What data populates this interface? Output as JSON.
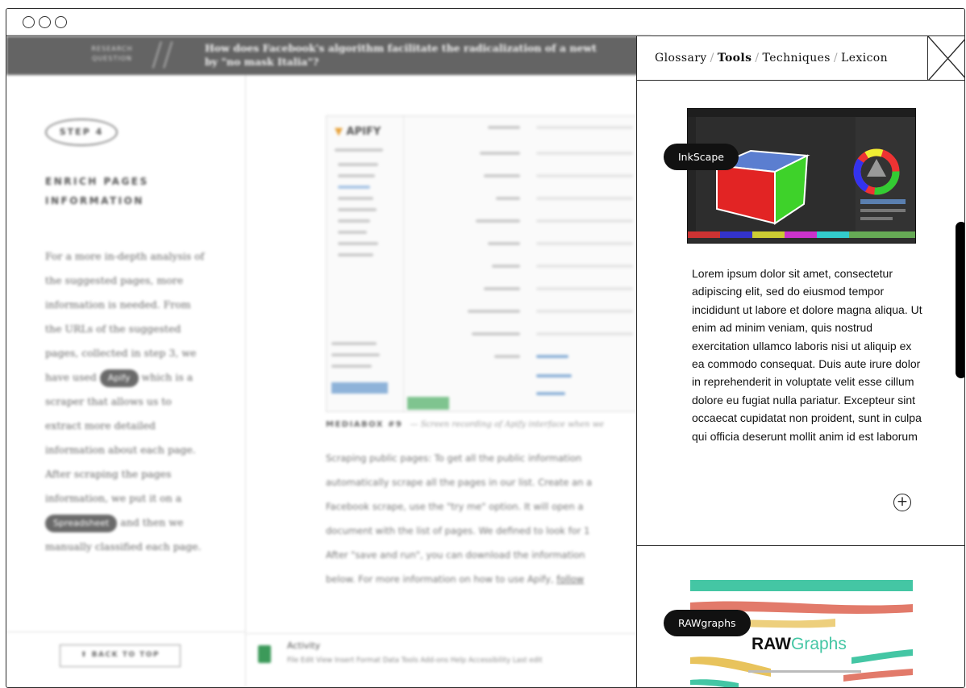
{
  "colors": {
    "accent_green": "#3fa36a",
    "raw_teal": "#44c6a4",
    "raw_yellow": "#e8c35c",
    "raw_red": "#e27a6a"
  },
  "research": {
    "label_line1": "RESEARCH",
    "label_line2": "QUESTION",
    "question": "How does Facebook's algorithm facilitate the radicalization of a newt",
    "question_line2": "by \"no mask Italia\"?"
  },
  "left": {
    "step": "STEP 4",
    "title_line1": "ENRICH PAGES",
    "title_line2": "INFORMATION",
    "para_a": "For a more in-depth analysis of the suggested pages, more information is needed. From the URLs of the suggested pages, collected in step 3, we have used",
    "apify_pill": "Apify",
    "para_b": "which is a scraper that allows us to extract more detailed information about each page. After scraping the pages information, we put it on a",
    "spreadsheet_pill": "Spreadsheet",
    "para_c": "and then we manually classified each page.",
    "back_to_top": "⬆ BACK TO TOP"
  },
  "mid": {
    "apify_logo": "APIFY",
    "caption_label": "MEDIABOX #9",
    "caption_text": "— Screen recording of Apify interface when we",
    "body_lines": [
      "Scraping public pages: To get all the public information",
      "automatically scrape all the pages in our list. Create an a",
      "Facebook scrape, use the \"try me\" option. It will open a",
      "document with the list of pages. We defined to look for 1",
      "After \"save and run\", you can download the information",
      "below. For more information on how to use Apify,"
    ],
    "body_link": "follow",
    "sheet_name": "Activity",
    "sheet_menu": "File  Edit  View  Insert  Format  Data  Tools  Add-ons  Help  Accessibility   Last edit"
  },
  "panel": {
    "nav": [
      {
        "label": "Glossary",
        "active": false
      },
      {
        "label": "Tools",
        "active": true
      },
      {
        "label": "Techniques",
        "active": false
      },
      {
        "label": "Lexicon",
        "active": false
      }
    ],
    "inkscape_tag": "InkScape",
    "description": "Lorem ipsum dolor sit amet, consectetur adipiscing elit, sed do eiusmod tempor incididunt ut labore et dolore magna aliqua. Ut enim ad minim veniam, quis nostrud exercitation ullamco laboris nisi ut aliquip ex ea commodo consequat. Duis aute irure dolor in reprehenderit in voluptate velit esse cillum dolore eu fugiat nulla pariatur. Excepteur sint occaecat cupidatat non proident, sunt in culpa qui officia deserunt mollit anim id est laborum",
    "expand_symbol": "+",
    "rawgraphs_tag": "RAWgraphs",
    "raw_logo_bold": "RAW",
    "raw_logo_rest": "Graphs"
  }
}
